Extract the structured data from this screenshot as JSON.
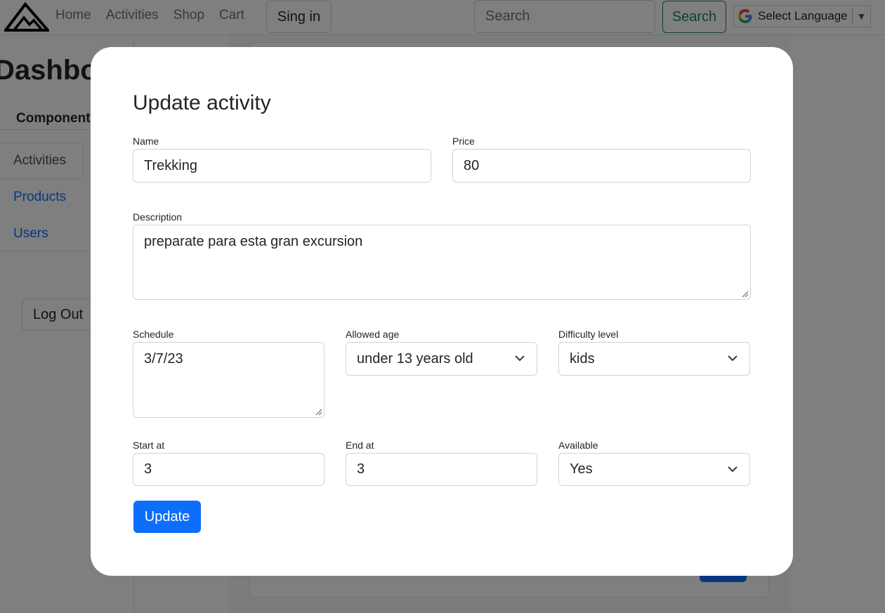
{
  "navbar": {
    "links": [
      "Home",
      "Activities",
      "Shop",
      "Cart"
    ],
    "signin_label": "Sing in",
    "search_placeholder": "Search",
    "search_button": "Search",
    "language_label": "Select Language",
    "language_caret": "▼"
  },
  "dashboard": {
    "title": "Dashboard",
    "components_label": "Components",
    "tabs": [
      "Activities",
      "Products",
      "Users"
    ],
    "logout_label": "Log Out"
  },
  "modal": {
    "title": "Update activity",
    "fields": {
      "name": {
        "label": "Name",
        "value": "Trekking"
      },
      "price": {
        "label": "Price",
        "value": "80"
      },
      "description": {
        "label": "Description",
        "value": "preparate para esta gran excursion"
      },
      "schedule": {
        "label": "Schedule",
        "value": "3/7/23"
      },
      "allowed_age": {
        "label": "Allowed age",
        "value": "under 13 years old"
      },
      "difficulty": {
        "label": "Difficulty level",
        "value": "kids"
      },
      "start_at": {
        "label": "Start at",
        "value": "3"
      },
      "end_at": {
        "label": "End at",
        "value": "3"
      },
      "available": {
        "label": "Available",
        "value": "Yes"
      }
    },
    "update_button": "Update"
  },
  "colors": {
    "primary": "#0d6efd",
    "success": "#198754",
    "backdrop": "rgba(0,0,0,0.5)"
  }
}
